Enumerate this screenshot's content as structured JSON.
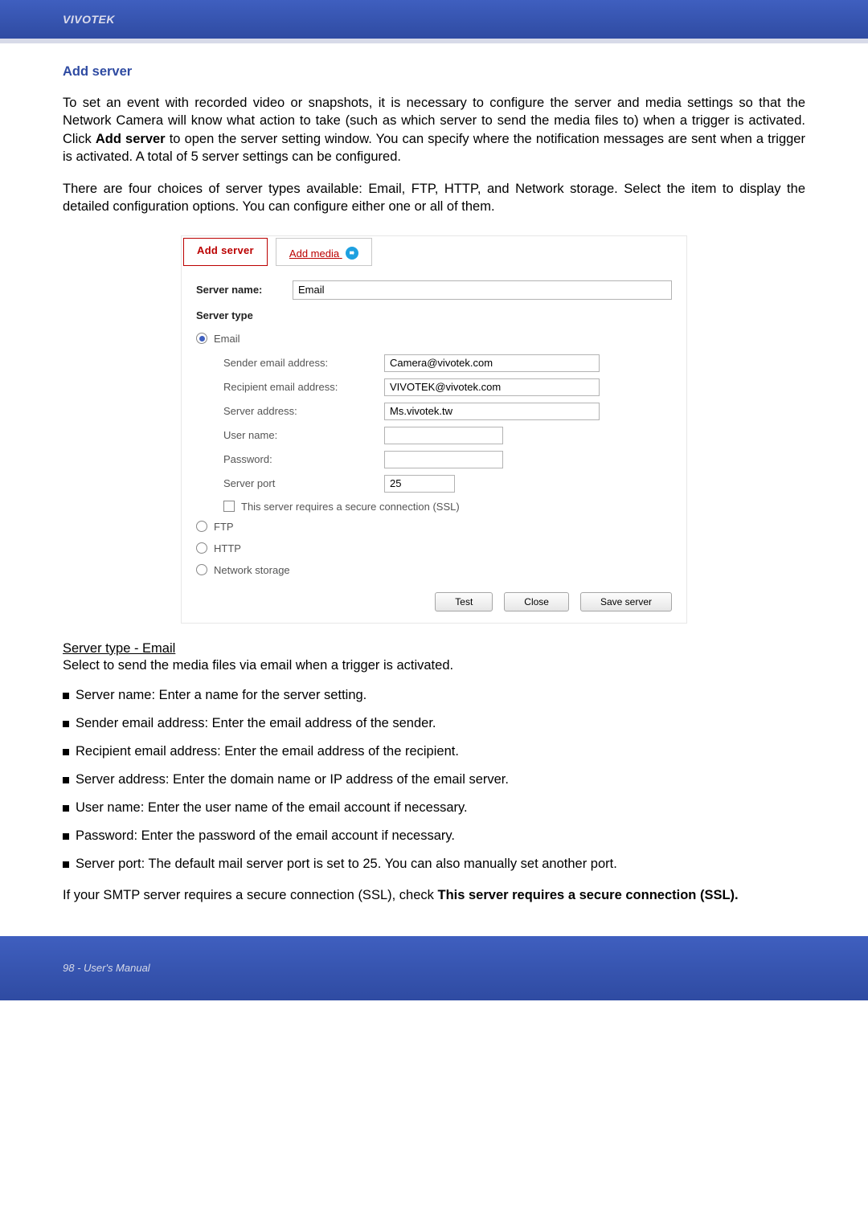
{
  "header": {
    "brand": "VIVOTEK"
  },
  "section": {
    "title": "Add server"
  },
  "intro": {
    "p1_a": "To set an event with recorded video or snapshots, it is necessary to configure the server and media settings so that the Network Camera will know what action to take (such as which server to send the media files to) when a trigger is activated. Click ",
    "p1_bold": "Add server",
    "p1_b": " to open the server setting window. You can specify where the notification messages are sent when a trigger is activated. A total of 5 server settings can be configured.",
    "p2": "There are four choices of server types available: Email, FTP, HTTP, and Network storage. Select the item to display the detailed configuration options. You can configure either one or all of them."
  },
  "dialog": {
    "tabs": {
      "add_server": "Add server",
      "add_media": "Add media"
    },
    "server_name_label": "Server name:",
    "server_name_value": "Email",
    "server_type_label": "Server type",
    "radios": {
      "email": "Email",
      "ftp": "FTP",
      "http": "HTTP",
      "network_storage": "Network storage"
    },
    "email": {
      "sender_label": "Sender email address:",
      "sender_value": "Camera@vivotek.com",
      "recipient_label": "Recipient email address:",
      "recipient_value": "VIVOTEK@vivotek.com",
      "server_addr_label": "Server address:",
      "server_addr_value": "Ms.vivotek.tw",
      "user_label": "User name:",
      "user_value": "",
      "pass_label": "Password:",
      "pass_value": "",
      "port_label": "Server port",
      "port_value": "25",
      "ssl_label": "This server requires a secure connection (SSL)"
    },
    "buttons": {
      "test": "Test",
      "close": "Close",
      "save": "Save server"
    }
  },
  "email_section": {
    "heading": "Server type - Email",
    "desc": "Select to send the media files via email when a trigger is activated.",
    "bullets": [
      "Server name: Enter a name for the server setting.",
      "Sender email address: Enter the email address of the sender.",
      "Recipient email address: Enter the email address of the recipient.",
      "Server address: Enter the domain name or IP address of the email server.",
      "User name: Enter the user name of the email account if necessary.",
      "Password: Enter the password of the email account if necessary.",
      "Server port: The default mail server port is set to 25. You can also manually set another port."
    ],
    "note_a": "If your SMTP server requires a secure connection (SSL), check ",
    "note_bold": "This server requires a secure connection (SSL)."
  },
  "footer": {
    "text": "98 - User's Manual"
  }
}
